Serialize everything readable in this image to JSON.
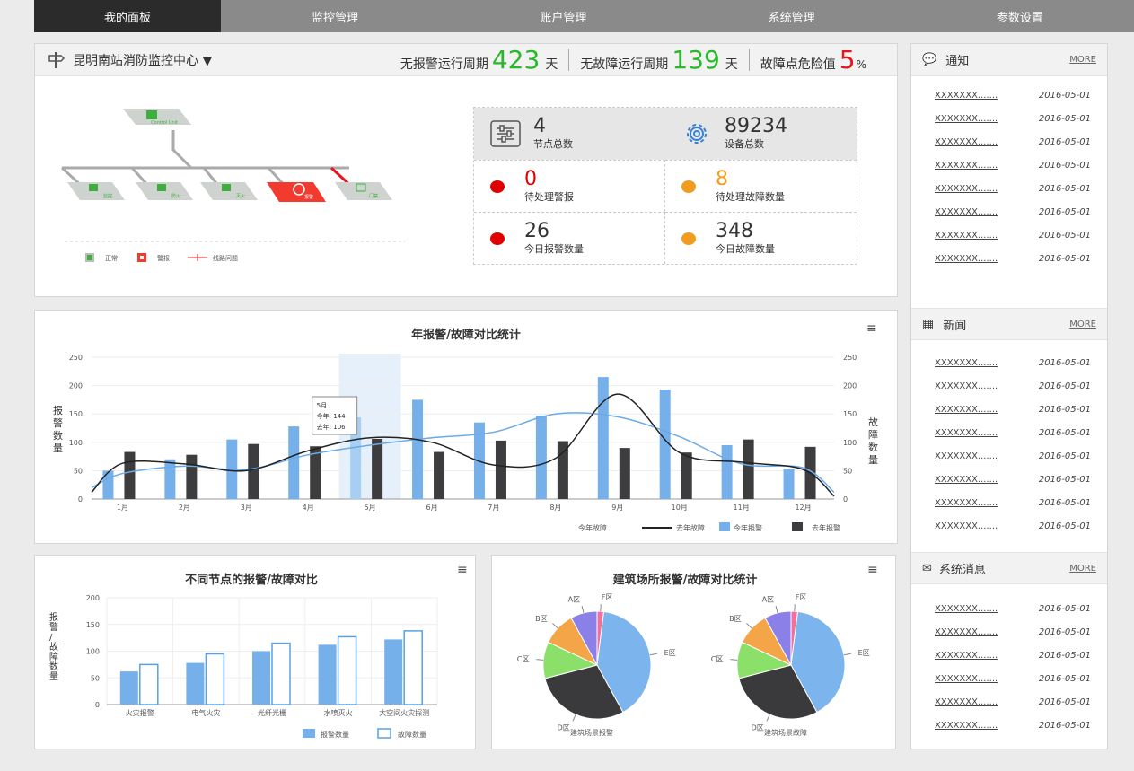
{
  "nav": [
    "我的面板",
    "监控管理",
    "账户管理",
    "系统管理",
    "参数设置"
  ],
  "main": {
    "station": "昆明南站消防监控中心",
    "s1_label": "无报警运行周期",
    "s1_value": "423",
    "s1_unit": "天",
    "s2_label": "无故障运行周期",
    "s2_value": "139",
    "s2_unit": "天",
    "s3_label": "故障点危险值",
    "s3_value": "5",
    "s3_unit": "%"
  },
  "topo": {
    "root": "Control Unit",
    "nodes": [
      "监控",
      "防火",
      "灭火",
      "报警",
      "门禁"
    ],
    "legend": [
      "正常",
      "警报",
      "线路问题"
    ]
  },
  "stats": {
    "node_count": "4",
    "node_label": "节点总数",
    "dev_count": "89234",
    "dev_label": "设备总数",
    "alarm": "0",
    "alarm_label": "待处理警报",
    "fault": "8",
    "fault_label": "待处理故障数量",
    "today_alarm": "26",
    "today_alarm_label": "今日报警数量",
    "today_fault": "348",
    "today_fault_label": "今日故障数量"
  },
  "colors": {
    "green": "#29b82c",
    "red": "#e8141d",
    "alarm": "#e00000",
    "warn": "#f29c1f",
    "blue": "#76b0eb",
    "dark": "#3d3d3f"
  },
  "chart1": {
    "title": "年报警/故障对比统计",
    "yl": "报警数量",
    "yr": "故障数量",
    "tip_title": "5月",
    "tip1": "今年: 144",
    "tip2": "去年: 106",
    "legend": [
      "今年故障",
      "去年故障",
      "今年报警",
      "去年报警"
    ]
  },
  "chart2": {
    "title": "不同节点的报警/故障对比",
    "ylabel": "报警/故障数量",
    "legend": [
      "报警数量",
      "故障数量"
    ]
  },
  "chart3": {
    "title": "建筑场所报警/故障对比统计",
    "label1": "建筑场景报警",
    "label2": "建筑场景故障"
  },
  "chart_data": [
    {
      "type": "bar",
      "title": "年报警/故障对比统计",
      "categories": [
        "1月",
        "2月",
        "3月",
        "4月",
        "5月",
        "6月",
        "7月",
        "8月",
        "9月",
        "10月",
        "11月",
        "12月"
      ],
      "ylim": [
        0,
        250
      ],
      "yticks": [
        0,
        50,
        100,
        150,
        200,
        250
      ],
      "series": [
        {
          "name": "今年报警",
          "values": [
            50,
            70,
            105,
            128,
            144,
            175,
            135,
            147,
            215,
            193,
            95,
            53
          ]
        },
        {
          "name": "去年报警",
          "values": [
            83,
            78,
            97,
            93,
            106,
            83,
            103,
            102,
            90,
            82,
            105,
            92
          ]
        },
        {
          "name": "今年故障",
          "values": [
            45,
            58,
            52,
            78,
            95,
            108,
            118,
            150,
            145,
            110,
            62,
            55
          ]
        },
        {
          "name": "去年故障",
          "values": [
            63,
            62,
            50,
            85,
            108,
            100,
            60,
            72,
            185,
            82,
            65,
            52
          ]
        }
      ]
    },
    {
      "type": "bar",
      "title": "不同节点的报警/故障对比",
      "categories": [
        "火灾报警",
        "电气火灾",
        "光纤光栅",
        "水喷灭火",
        "大空间火灾探测"
      ],
      "ylim": [
        0,
        200
      ],
      "yticks": [
        0,
        50,
        100,
        150,
        200
      ],
      "series": [
        {
          "name": "报警数量",
          "values": [
            62,
            78,
            100,
            112,
            122
          ]
        },
        {
          "name": "故障数量",
          "values": [
            75,
            95,
            115,
            127,
            138
          ]
        }
      ]
    },
    {
      "type": "pie",
      "title": "建筑场景报警",
      "categories": [
        "A区",
        "B区",
        "C区",
        "D区",
        "E区",
        "F区"
      ],
      "values": [
        8,
        10,
        11,
        29,
        40,
        2
      ]
    },
    {
      "type": "pie",
      "title": "建筑场景故障",
      "categories": [
        "A区",
        "B区",
        "C区",
        "D区",
        "E区",
        "F区"
      ],
      "values": [
        8,
        10,
        11,
        29,
        40,
        2
      ]
    }
  ],
  "side": {
    "more": "MORE",
    "notice_title": "通知",
    "news_title": "新闻",
    "msg_title": "系统消息",
    "item_text": "XXXXXXX.......",
    "item_date": "2016-05-01"
  }
}
